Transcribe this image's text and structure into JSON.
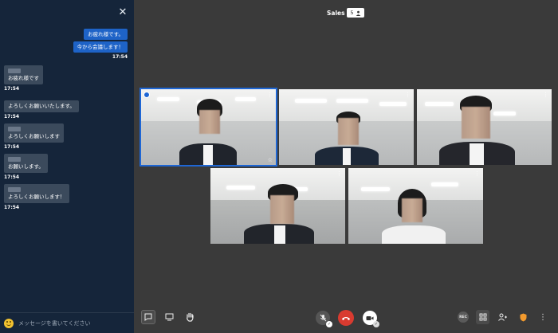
{
  "chat": {
    "messages_out": [
      {
        "text": "お疲れ様です。"
      },
      {
        "text": "今から会議します！"
      }
    ],
    "out_time": "17:54",
    "messages_in": [
      {
        "text": "お疲れ様です",
        "time": "17:54"
      },
      {
        "text": "よろしくお願いいたします。",
        "time": "17:54",
        "no_sender": true
      },
      {
        "text": "よろしくお願いします",
        "time": "17:54"
      },
      {
        "text": "お願いします。",
        "time": "17:54"
      },
      {
        "text": "よろしくお願いします！",
        "time": "17:54"
      }
    ],
    "input_placeholder": "メッセージを書いてください"
  },
  "header": {
    "title": "Sales",
    "participant_count": "5"
  },
  "toolbar": {
    "rec_label": "REC"
  },
  "colors": {
    "sidebar_bg": "#15253a",
    "stage_bg": "#3a3a3a",
    "accent_blue": "#1e66d4",
    "hangup_red": "#d93b30"
  }
}
